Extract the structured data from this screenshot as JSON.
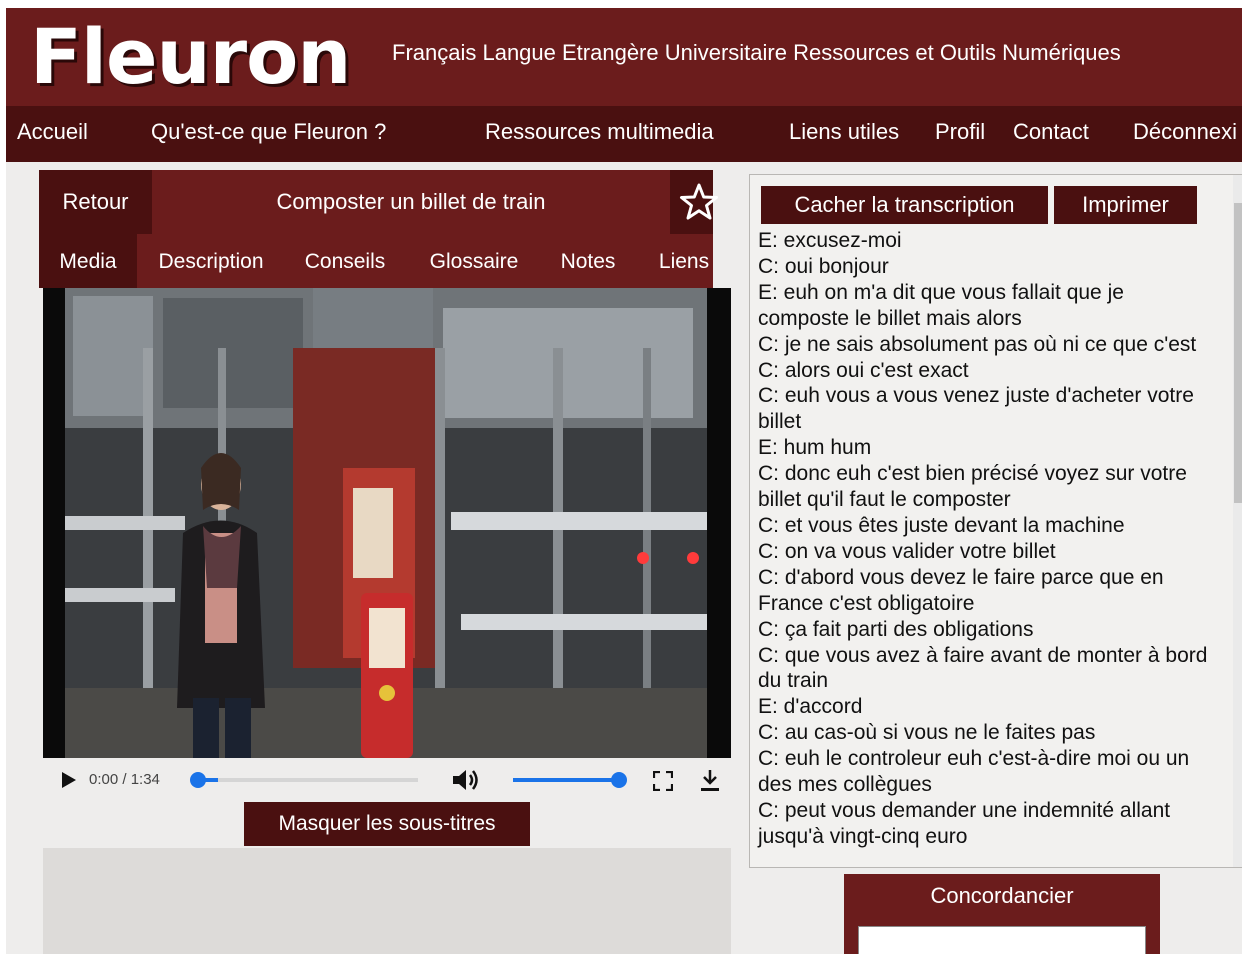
{
  "header": {
    "logo": "Fleuron",
    "tagline": "Français Langue Etrangère Universitaire Ressources et Outils Numériques"
  },
  "nav": [
    "Accueil",
    "Qu'est-ce que Fleuron ?",
    "Ressources multimedia",
    "Liens utiles",
    "Profil",
    "Contact",
    "Déconnexi"
  ],
  "lesson": {
    "back_label": "Retour",
    "title": "Composter un billet de train",
    "favorite_icon": "star-icon"
  },
  "tabs": [
    "Media",
    "Description",
    "Conseils",
    "Glossaire",
    "Notes",
    "Liens"
  ],
  "active_tab": "Media",
  "player": {
    "time": "0:00 / 1:34",
    "progress": 0.0,
    "volume": 1.0,
    "icons": [
      "play-icon",
      "volume-icon",
      "fullscreen-icon",
      "download-icon"
    ]
  },
  "subtitles_button": "Masquer les sous-titres",
  "transcript": {
    "hide_label": "Cacher la transcription",
    "print_label": "Imprimer",
    "lines": [
      "E: excusez-moi",
      "C: oui bonjour",
      "E: euh on m'a dit que vous fallait que je composte le billet mais alors",
      "C: je ne sais absolument pas où ni ce que c'est",
      "C: alors oui c'est exact",
      "C: euh vous a vous venez juste d'acheter votre billet",
      "E: hum hum",
      "C: donc euh c'est bien précisé voyez sur votre billet qu'il faut le composter",
      "C: et vous êtes juste devant la machine",
      "C: on va vous valider votre billet",
      "C: d'abord vous devez le faire parce que en France c'est obligatoire",
      "C: ça fait parti des obligations",
      "C: que vous avez à faire avant de monter à bord du train",
      "E: d'accord",
      "C: au cas-où si vous ne le faites pas",
      "C: euh le controleur euh c'est-à-dire moi ou un des mes collègues",
      "C: peut vous demander une indemnité allant jusqu'à vingt-cinq euro"
    ]
  },
  "concordancier_label": "Concordancier",
  "colors": {
    "header": "#6b1c1c",
    "nav": "#4a1010",
    "accent_blue": "#1a73e8"
  }
}
